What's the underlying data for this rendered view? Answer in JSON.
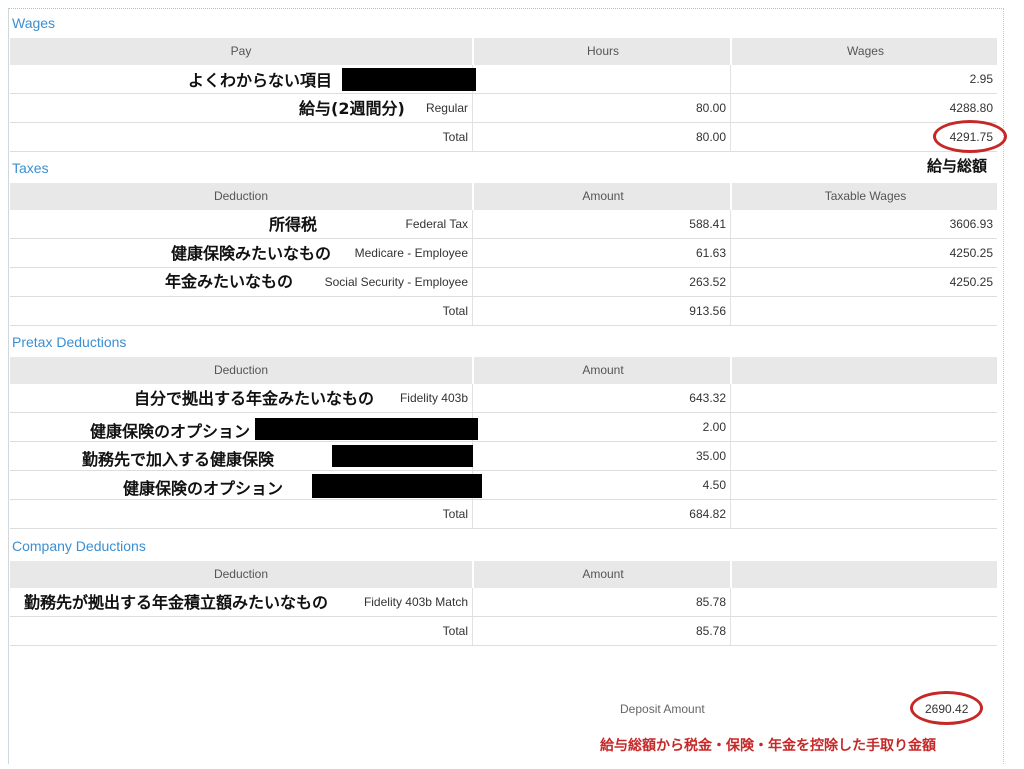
{
  "wages": {
    "title": "Wages",
    "headers": [
      "Pay",
      "Hours",
      "Wages"
    ],
    "rows": [
      {
        "jp": "よくわからない項目",
        "pay": "",
        "hours": "",
        "wages": "2.95"
      },
      {
        "jp": "給与(2週間分)",
        "pay": "Regular",
        "hours": "80.00",
        "wages": "4288.80"
      },
      {
        "jp": "",
        "pay": "Total",
        "hours": "80.00",
        "wages": "4291.75"
      }
    ],
    "total_note": "給与総額"
  },
  "taxes": {
    "title": "Taxes",
    "headers": [
      "Deduction",
      "Amount",
      "Taxable Wages"
    ],
    "rows": [
      {
        "jp": "所得税",
        "pay": "Federal Tax",
        "amount": "588.41",
        "taxable": "3606.93"
      },
      {
        "jp": "健康保険みたいなもの",
        "pay": "Medicare - Employee",
        "amount": "61.63",
        "taxable": "4250.25"
      },
      {
        "jp": "年金みたいなもの",
        "pay": "Social Security - Employee",
        "amount": "263.52",
        "taxable": "4250.25"
      },
      {
        "jp": "",
        "pay": "Total",
        "amount": "913.56",
        "taxable": ""
      }
    ]
  },
  "pretax": {
    "title": "Pretax Deductions",
    "headers": [
      "Deduction",
      "Amount",
      ""
    ],
    "rows": [
      {
        "jp": "自分で拠出する年金みたいなもの",
        "pay": "Fidelity 403b",
        "amount": "643.32"
      },
      {
        "jp": "健康保険のオプション",
        "pay": "",
        "amount": "2.00"
      },
      {
        "jp": "勤務先で加入する健康保険",
        "pay": "",
        "amount": "35.00"
      },
      {
        "jp": "健康保険のオプション",
        "pay": "",
        "amount": "4.50"
      },
      {
        "jp": "",
        "pay": "Total",
        "amount": "684.82"
      }
    ]
  },
  "company": {
    "title": "Company Deductions",
    "headers": [
      "Deduction",
      "Amount",
      ""
    ],
    "rows": [
      {
        "jp": "勤務先が拠出する年金積立額みたいなもの",
        "pay": "Fidelity 403b Match",
        "amount": "85.78"
      },
      {
        "jp": "",
        "pay": "Total",
        "amount": "85.78"
      }
    ]
  },
  "deposit": {
    "label": "Deposit Amount",
    "amount": "2690.42",
    "note": "給与総額から税金・保険・年金を控除した手取り金額"
  },
  "colors": {
    "section_title": "#3b8fd0",
    "header_bg": "#e8e8e8",
    "annotation_red": "#c62828",
    "redaction": "#000000"
  }
}
